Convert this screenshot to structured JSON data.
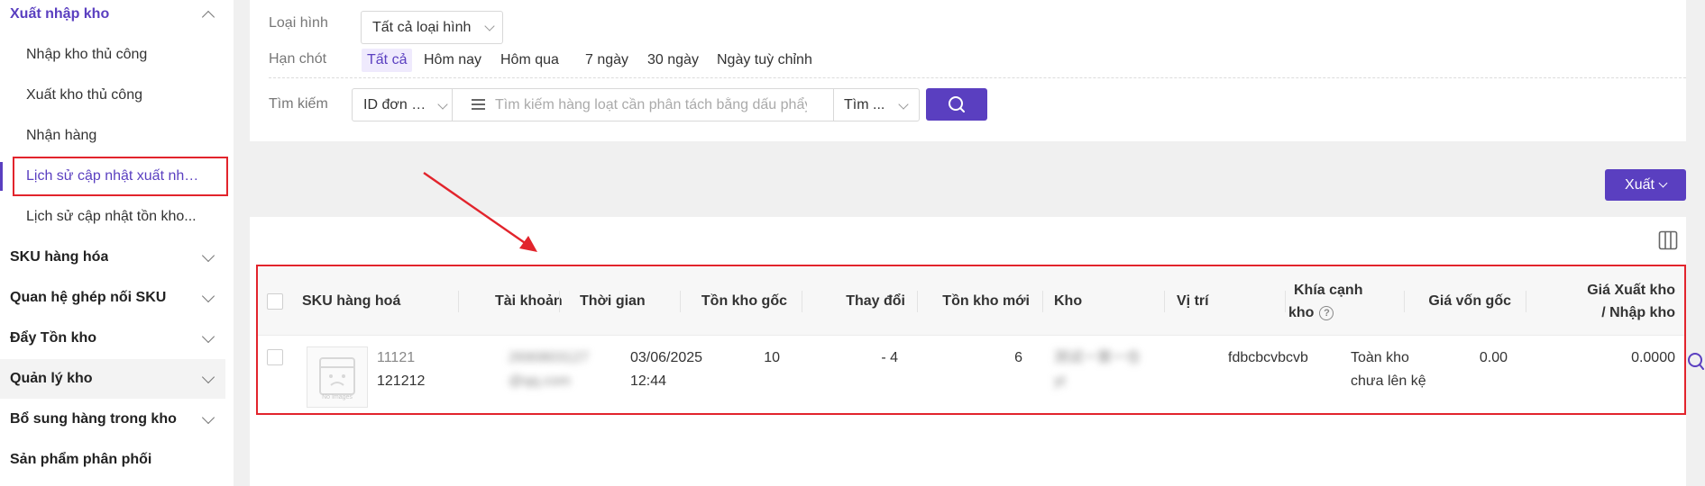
{
  "sidebar": {
    "section": {
      "label": "Xuất nhập kho"
    },
    "sub_items": [
      {
        "label": "Nhập kho thủ công"
      },
      {
        "label": "Xuất kho thủ công"
      },
      {
        "label": "Nhận hàng"
      },
      {
        "label": "Lịch sử cập nhật xuất nhập..."
      },
      {
        "label": "Lịch sử cập nhật tồn kho..."
      }
    ],
    "groups": [
      {
        "label": "SKU hàng hóa"
      },
      {
        "label": "Quan hệ ghép nối SKU"
      },
      {
        "label": "Đẩy Tồn kho"
      },
      {
        "label": "Quản lý kho"
      },
      {
        "label": "Bổ sung hàng trong kho"
      },
      {
        "label": "Sản phẩm phân phối"
      }
    ]
  },
  "filters": {
    "type_label": "Loại hình",
    "type_value": "Tất cả loại hình",
    "deadline_label": "Hạn chót",
    "date_options": [
      "Tất cả",
      "Hôm nay",
      "Hôm qua",
      "7 ngày",
      "30 ngày",
      "Ngày tuỳ chỉnh"
    ],
    "search_label": "Tìm kiếm",
    "search_field": "ID đơn h...",
    "search_placeholder": "Tìm kiếm hàng loạt cần phân tách bằng dấu phẩy",
    "search_mode": "Tìm ..."
  },
  "toolbar": {
    "export_label": "Xuất"
  },
  "table": {
    "headers": {
      "sku": "SKU hàng hoá",
      "account": "Tài khoản",
      "time": "Thời gian",
      "original_stock": "Tồn kho gốc",
      "change": "Thay đổi",
      "new_stock": "Tồn kho mới",
      "warehouse": "Kho",
      "location": "Vị trí",
      "aspect_line1": "Khía cạnh",
      "aspect_line2": "kho",
      "cost_price": "Giá vốn gốc",
      "io_price_line1": "Giá Xuất kho",
      "io_price_line2": "/ Nhập kho"
    },
    "rows": [
      {
        "thumb_text": "No Images",
        "sku_line1": "11121",
        "sku_line2": "121212",
        "account_line1": "2690803127",
        "account_line2": "@qq.com",
        "time_line1": "03/06/2025",
        "time_line2": "12:44",
        "original_stock": "10",
        "change": "- 4",
        "new_stock": "6",
        "warehouse_line1": "测试一第一仓",
        "warehouse_line2": "yt",
        "location": "fdbcbcvbcvb",
        "aspect_line1": "Toàn kho",
        "aspect_line2": "chưa lên kệ",
        "cost_price": "0.00",
        "io_price": "0.0000"
      }
    ]
  },
  "colors": {
    "accent": "#5a3fc0",
    "annotation": "#e2242c"
  }
}
